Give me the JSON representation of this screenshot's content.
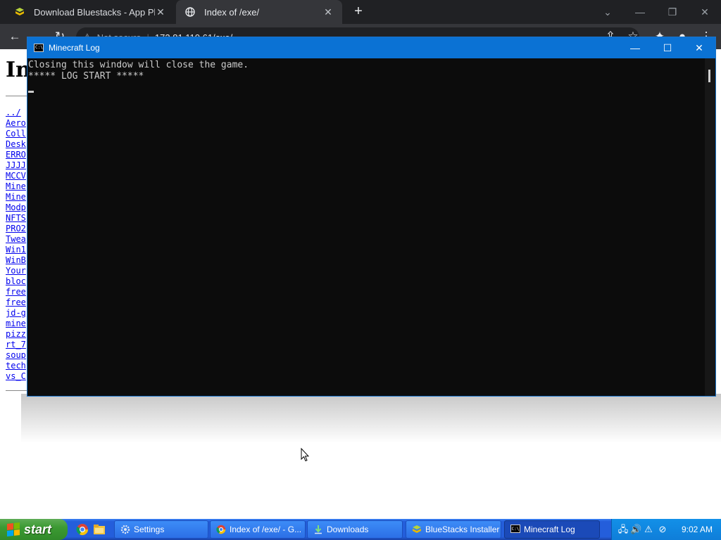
{
  "browser": {
    "tabs": [
      {
        "title": "Download Bluestacks - App Playe",
        "icon": "bluestacks-icon"
      },
      {
        "title": "Index of /exe/",
        "icon": "globe-icon",
        "active": true
      }
    ],
    "address": {
      "security": "Not secure",
      "url": "172.81.110.61/exe/"
    }
  },
  "page": {
    "heading": "Index of /exe/",
    "files": [
      "../",
      "Aero",
      "Coll",
      "Desk",
      "ERRO",
      "JJJJ",
      "MCCV",
      "Mine",
      "Mine",
      "Modp",
      "NFTS",
      "PRO2",
      "Twea",
      "Win1",
      "WinB",
      "Your",
      "bloc",
      "free",
      "free",
      "jd-g",
      "mine",
      "pizz",
      "rt_7",
      "soup",
      "tech",
      "vs_C"
    ]
  },
  "console": {
    "title": "Minecraft Log",
    "lines": [
      "Closing this window will close the game.",
      "***** LOG START *****"
    ]
  },
  "taskbar": {
    "start_label": "start",
    "items": [
      {
        "label": "Settings",
        "icon": "gear-icon"
      },
      {
        "label": "Index of /exe/ - G...",
        "icon": "chrome-icon"
      },
      {
        "label": "Downloads",
        "icon": "download-icon"
      },
      {
        "label": "BlueStacks Installer",
        "icon": "bluestacks-icon"
      },
      {
        "label": "Minecraft Log",
        "icon": "console-icon",
        "active": true
      }
    ],
    "clock": "9:02 AM"
  },
  "colors": {
    "console_title": "#0b72d4",
    "console_bg": "#0c0c0c",
    "taskbar": "#245edb",
    "start": "#3c9a33"
  }
}
